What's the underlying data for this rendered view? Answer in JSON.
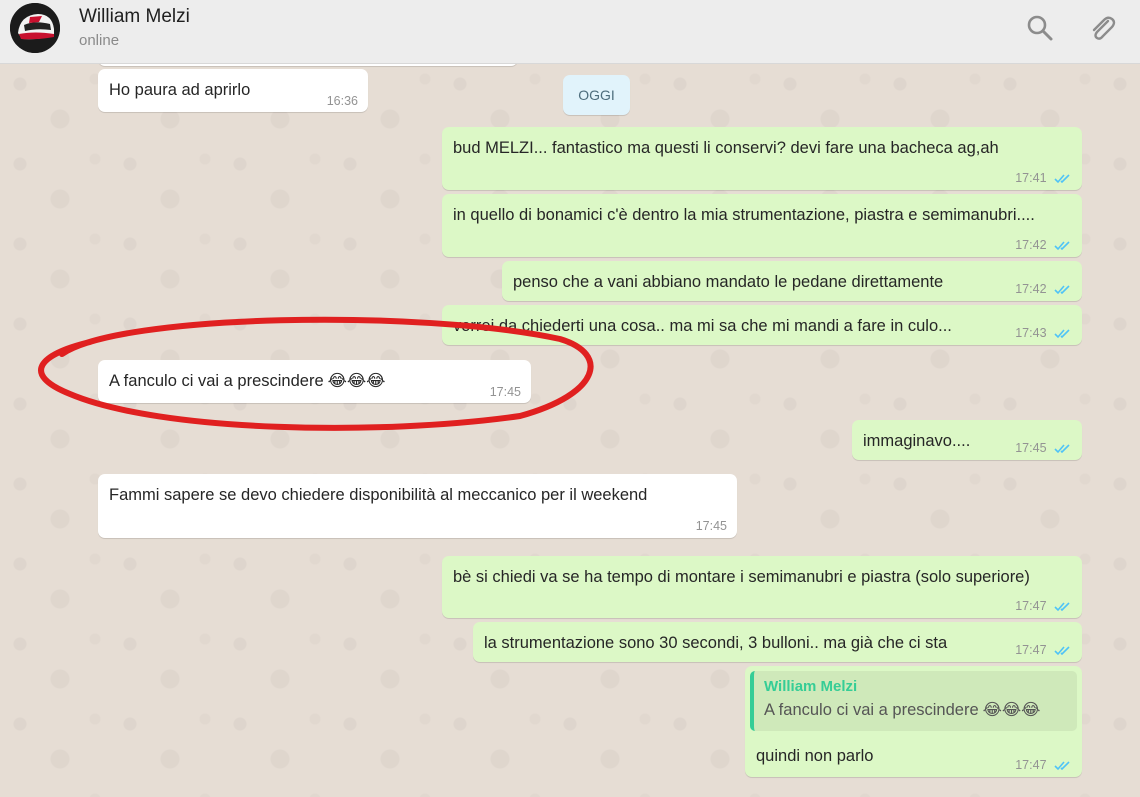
{
  "header": {
    "contact_name": "William Melzi",
    "status": "online",
    "icons": [
      "search-icon",
      "paperclip-icon"
    ]
  },
  "day_divider": "OGGI",
  "colors": {
    "incoming_bubble": "#ffffff",
    "outgoing_bubble": "#dcf8c6",
    "read_ticks": "#4fc3f7",
    "quote_accent": "#35cd96",
    "annotation_circle": "#e02020"
  },
  "messages": [
    {
      "direction": "in",
      "text": "Ho paura ad aprirlo",
      "time": "16:36"
    },
    {
      "direction": "out",
      "text": "bud MELZI... fantastico ma questi li conservi? devi fare una bacheca ag,ah",
      "time": "17:41"
    },
    {
      "direction": "out",
      "text": "in quello di bonamici c'è dentro la mia strumentazione, piastra e semimanubri....",
      "time": "17:42"
    },
    {
      "direction": "out",
      "text": "penso che a vani abbiano mandato le pedane direttamente",
      "time": "17:42"
    },
    {
      "direction": "out",
      "text": "vorrei da chiederti una cosa.. ma mi sa che mi mandi a fare in culo...",
      "time": "17:43"
    },
    {
      "direction": "in",
      "text": "A fanculo ci vai a prescindere",
      "emoji": "😂😂😂",
      "time": "17:45"
    },
    {
      "direction": "out",
      "text": "immaginavo....",
      "time": "17:45"
    },
    {
      "direction": "in",
      "text": "Fammi sapere se devo chiedere disponibilità al meccanico per il weekend",
      "time": "17:45"
    },
    {
      "direction": "out",
      "text": "bè si chiedi va se ha tempo di montare i semimanubri e piastra (solo superiore)",
      "time": "17:47"
    },
    {
      "direction": "out",
      "text": "la strumentazione sono 30 secondi, 3 bulloni.. ma già che ci sta",
      "time": "17:47"
    },
    {
      "direction": "out",
      "text": "quindi non parlo",
      "time": "17:47",
      "quote": {
        "author": "William Melzi",
        "text": "A fanculo ci vai a prescindere",
        "emoji": "😂😂😂"
      }
    }
  ]
}
